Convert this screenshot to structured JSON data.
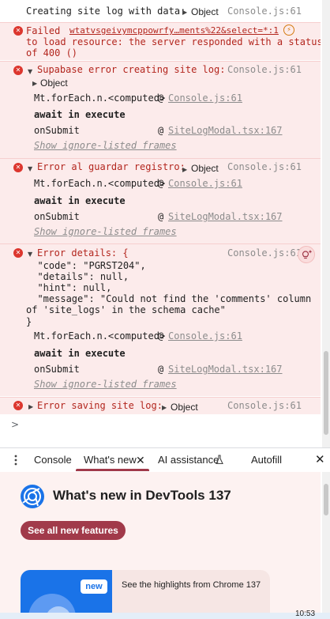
{
  "console": {
    "log1": {
      "text": "Creating site log with data:",
      "object_label": "Object",
      "source": "Console.js:61"
    },
    "err_failed": {
      "prefix": "Failed",
      "url": "wtatvsgeivymcppowrfy…ments%22&select=*:1",
      "line2": "to load resource: the server responded with a status",
      "line3": "of 400 ()"
    },
    "err_supabase": {
      "message": "Supabase error creating site log:",
      "object_label": "Object",
      "source": "Console.js:61",
      "stack": [
        {
          "fn": "Mt.forEach.n.<computed>",
          "at": "@",
          "loc": "Console.js:61"
        },
        {
          "fn": "await in execute",
          "bold": true
        },
        {
          "fn": "onSubmit",
          "at": "@",
          "loc": "SiteLogModal.tsx:167"
        }
      ],
      "ignore_link": "Show ignore-listed frames"
    },
    "err_guardar": {
      "message": "Error al guardar registro:",
      "object_label": "Object",
      "source": "Console.js:61",
      "stack": [
        {
          "fn": "Mt.forEach.n.<computed>",
          "at": "@",
          "loc": "Console.js:61"
        },
        {
          "fn": "await in execute",
          "bold": true
        },
        {
          "fn": "onSubmit",
          "at": "@",
          "loc": "SiteLogModal.tsx:167"
        }
      ],
      "ignore_link": "Show ignore-listed frames"
    },
    "err_details": {
      "message": "Error details: {",
      "source": "Console.js:61",
      "json_lines": [
        "  \"code\": \"PGRST204\",",
        "  \"details\": null,",
        "  \"hint\": null,",
        "  \"message\": \"Could not find the 'comments' column",
        "of 'site_logs' in the schema cache\"",
        "}"
      ],
      "stack": [
        {
          "fn": "Mt.forEach.n.<computed>",
          "at": "@",
          "loc": "Console.js:61"
        },
        {
          "fn": "await in execute",
          "bold": true
        },
        {
          "fn": "onSubmit",
          "at": "@",
          "loc": "SiteLogModal.tsx:167"
        }
      ],
      "ignore_link": "Show ignore-listed frames"
    },
    "err_saving": {
      "message": "Error saving site log:",
      "object_label": "Object",
      "source": "Console.js:61"
    },
    "prompt": ">"
  },
  "drawer": {
    "tabs": [
      {
        "label": "Console"
      },
      {
        "label": "What's new"
      },
      {
        "label": "AI assistance"
      },
      {
        "label": "Autofill"
      }
    ]
  },
  "whatsnew": {
    "title": "What's new in DevTools 137",
    "cta": "See all new features",
    "card_badge": "new",
    "card_text": "See the highlights from Chrome 137"
  },
  "taskbar": {
    "clock": "10:53"
  },
  "colors": {
    "accent": "#a13a4a",
    "error_bg": "#fcebeb",
    "error_icon": "#dc362e",
    "chrome_blue": "#1a73e8"
  }
}
